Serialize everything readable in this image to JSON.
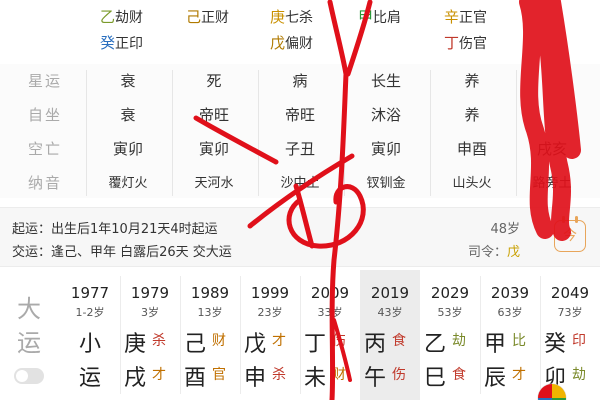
{
  "hidden_stems": {
    "row1": [
      {
        "char": "乙",
        "name": "劫财",
        "color": "#7a9a2a"
      },
      {
        "char": "己",
        "name": "正财",
        "color": "#b07a00"
      },
      {
        "char": "庚",
        "name": "七杀",
        "color": "#c99000"
      },
      {
        "char": "甲",
        "name": "比肩",
        "color": "#2a9a3a"
      },
      {
        "char": "辛",
        "name": "正官",
        "color": "#c99000"
      }
    ],
    "row2": [
      {
        "char": "癸",
        "name": "正印",
        "color": "#2a6fbf"
      },
      {
        "char": "戊",
        "name": "偏财",
        "color": "#b07a00"
      },
      {
        "char": "丁",
        "name": "伤官",
        "color": "#c0392b"
      }
    ]
  },
  "pillars": {
    "rows": [
      {
        "label": "星运",
        "cells": [
          "衰",
          "死",
          "病",
          "长生",
          "养"
        ]
      },
      {
        "label": "自坐",
        "cells": [
          "衰",
          "帝旺",
          "帝旺",
          "沐浴",
          "养"
        ]
      },
      {
        "label": "空亡",
        "cells": [
          "寅卯",
          "寅卯",
          "子丑",
          "寅卯",
          "申酉",
          "戌亥"
        ]
      },
      {
        "label": "纳音",
        "cells": [
          "覆灯火",
          "天河水",
          "沙中土",
          "钗钏金",
          "山头火",
          "路旁土"
        ]
      }
    ]
  },
  "info": {
    "qiyun": "起运：出生后1年10月21天4时起运",
    "jiaoyun": "交运：逢己、甲年 白露后26天 交大运",
    "age": "48岁",
    "siling_label": "司令：",
    "siling_value": "戊",
    "cal_glyph": "今"
  },
  "dayun": {
    "label_top": "大",
    "label_bottom": "运",
    "columns": [
      {
        "year": "1977",
        "age": "1-2岁",
        "top": "小",
        "bottom": "运"
      },
      {
        "year": "1979",
        "age": "3岁",
        "stem": "庚",
        "stem_god": "杀",
        "branch": "戌",
        "branch_god": "才"
      },
      {
        "year": "1989",
        "age": "13岁",
        "stem": "己",
        "stem_god": "财",
        "branch": "酉",
        "branch_god": "官"
      },
      {
        "year": "1999",
        "age": "23岁",
        "stem": "戊",
        "stem_god": "才",
        "branch": "申",
        "branch_god": "杀"
      },
      {
        "year": "2009",
        "age": "33岁",
        "stem": "丁",
        "stem_god": "伤",
        "branch": "未",
        "branch_god": "财"
      },
      {
        "year": "2019",
        "age": "43岁",
        "stem": "丙",
        "stem_god": "食",
        "branch": "午",
        "branch_god": "伤",
        "selected": true
      },
      {
        "year": "2029",
        "age": "53岁",
        "stem": "乙",
        "stem_god": "劫",
        "branch": "巳",
        "branch_god": "食"
      },
      {
        "year": "2039",
        "age": "63岁",
        "stem": "甲",
        "stem_god": "比",
        "branch": "辰",
        "branch_god": "才"
      },
      {
        "year": "2049",
        "age": "73岁",
        "stem": "癸",
        "stem_god": "印",
        "branch": "卯",
        "branch_god": "劫"
      }
    ]
  },
  "colors": {
    "accent_orange": "#e8a55a",
    "god_red": "#c0392b",
    "annotation_red": "#e0101a"
  }
}
